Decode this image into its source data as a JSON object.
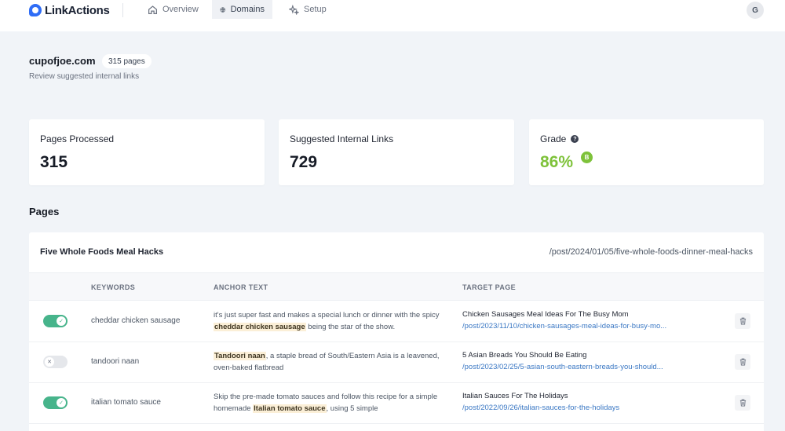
{
  "app": {
    "name": "LinkActions",
    "nav": [
      {
        "label": "Overview",
        "icon": "home-icon"
      },
      {
        "label": "Domains",
        "icon": "globe-icon",
        "active": true
      },
      {
        "label": "Setup",
        "icon": "sparkles-icon"
      }
    ],
    "user_initial": "G"
  },
  "domain": {
    "name": "cupofjoe.com",
    "pages_badge": "315 pages",
    "subtitle": "Review suggested internal links"
  },
  "stats": {
    "pages_processed": {
      "label": "Pages Processed",
      "value": "315"
    },
    "suggested_links": {
      "label": "Suggested Internal Links",
      "value": "729"
    },
    "grade": {
      "label": "Grade",
      "help": "?",
      "value": "86%",
      "letter": "B",
      "color": "#7ec23a"
    }
  },
  "pages_section": {
    "title": "Pages",
    "page": {
      "title": "Five Whole Foods Meal Hacks",
      "path": "/post/2024/01/05/five-whole-foods-dinner-meal-hacks"
    },
    "columns": {
      "keywords": "KEYWORDS",
      "anchor": "ANCHOR TEXT",
      "target": "TARGET PAGE"
    },
    "rows": [
      {
        "enabled": true,
        "keyword": "cheddar chicken sausage",
        "anchor_before": "it's just super fast and makes a special lunch or dinner with the spicy ",
        "anchor_highlight": "cheddar chicken sausage",
        "anchor_after": " being the star of the show.",
        "target_title": "Chicken Sausages Meal Ideas For The Busy Mom",
        "target_url": "/post/2023/11/10/chicken-sausages-meal-ideas-for-busy-mo..."
      },
      {
        "enabled": false,
        "keyword": "tandoori naan",
        "anchor_before": "",
        "anchor_highlight": "Tandoori naan",
        "anchor_after": ", a staple bread of South/Eastern Asia is a leavened, oven-baked flatbread",
        "target_title": "5 Asian Breads You Should Be Eating",
        "target_url": "/post/2023/02/25/5-asian-south-eastern-breads-you-should..."
      },
      {
        "enabled": true,
        "keyword": "italian tomato sauce",
        "anchor_before": "Skip the pre-made tomato sauces and follow this recipe for a simple homemade ",
        "anchor_highlight": "Italian tomato sauce",
        "anchor_after": ", using 5 simple",
        "target_title": "Italian Sauces For The Holidays",
        "target_url": "/post/2022/09/26/italian-sauces-for-the-holidays"
      }
    ]
  }
}
